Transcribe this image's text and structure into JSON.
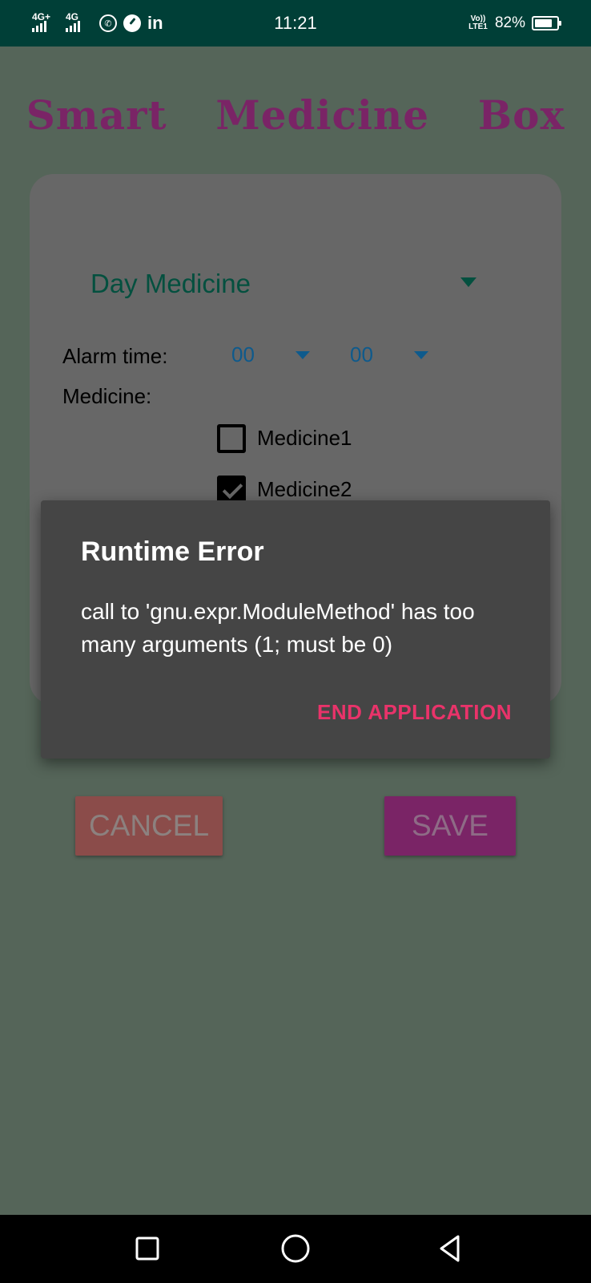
{
  "status_bar": {
    "sim1_network": "4G+",
    "sim2_network": "4G",
    "time": "11:21",
    "volte": "VoLTE1",
    "volte_line1": "Vo))",
    "volte_line2": "LTE1",
    "battery_percent": "82%",
    "battery_level": 0.82,
    "left_icons": [
      "signal-icon",
      "signal-icon",
      "whatsapp-icon",
      "app-icon",
      "linkedin-icon"
    ],
    "linkedin_text": "in",
    "whatsapp_glyph": "✆"
  },
  "app": {
    "title": "Smart  Medicine  Box"
  },
  "form": {
    "schedule_dropdown": {
      "value": "Day Medicine"
    },
    "alarm_label": "Alarm time:",
    "hour_dropdown": {
      "value": "00"
    },
    "minute_dropdown": {
      "value": "00"
    },
    "medicine_label": "Medicine:",
    "medicines": [
      {
        "label": "Medicine1",
        "checked": false
      },
      {
        "label": "Medicine2",
        "checked": true
      }
    ]
  },
  "buttons": {
    "cancel": "CANCEL",
    "save": "SAVE"
  },
  "dialog": {
    "title": "Runtime Error",
    "message": "call to 'gnu.expr.ModuleMethod' has too many arguments (1; must be 0)",
    "action": "END APPLICATION"
  },
  "colors": {
    "status_bar": "#003F37",
    "scrim_background": "#556559",
    "title": "#7A2466",
    "dialog_bg": "#454545",
    "dialog_action": "#E9336A",
    "dropdown_text": "#04503F",
    "time_text": "#0E5A8C"
  },
  "nav_bar": {
    "buttons": [
      "recent-apps-icon",
      "home-icon",
      "back-icon"
    ]
  }
}
